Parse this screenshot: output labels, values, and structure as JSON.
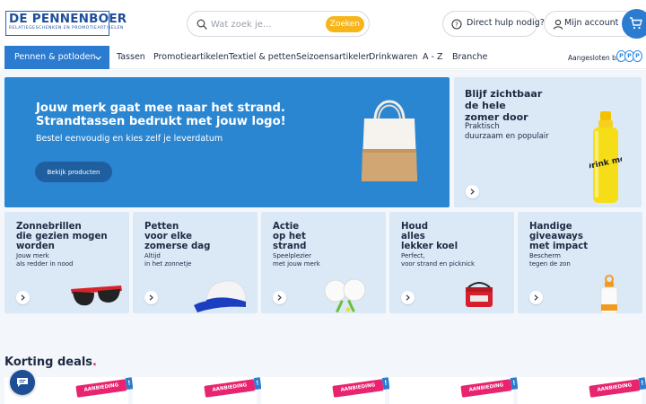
{
  "header": {
    "logo_main": "DE PENNENBOER",
    "logo_sub": "RELATIEGESCHENKEN EN PROMOTIEARTIKELEN",
    "search_placeholder": "Wat zoek je...",
    "search_button": "Zoeken",
    "help_label": "Direct hulp nodig?",
    "account_label": "Mijn account"
  },
  "nav": {
    "active_label": "Pennen & potloden",
    "items": [
      "Tassen",
      "Promotieartikelen",
      "Textiel & petten",
      "Seizoensartikelen",
      "Drinkwaren",
      "A - Z",
      "Branche"
    ],
    "aangesloten": "Aangesloten bij",
    "dots": [
      "P",
      "P",
      "P"
    ]
  },
  "hero": {
    "title_line1": "Jouw merk gaat mee naar het strand.",
    "title_line2": "Strandtassen bedrukt met jouw logo!",
    "subtitle": "Bestel eenvoudig en kies zelf je leverdatum",
    "button": "Bekijk producten"
  },
  "summer": {
    "title": [
      "Blijf zichtbaar",
      "de hele",
      "zomer door"
    ],
    "sub": [
      "Praktisch",
      "duurzaam en populair"
    ],
    "bottle_text": "Drink me"
  },
  "cards": [
    {
      "title": [
        "Zonnebrillen",
        "die gezien mogen",
        "worden"
      ],
      "sub": [
        "Jouw merk",
        "als redder in nood"
      ]
    },
    {
      "title": [
        "Petten",
        "voor elke",
        "zomerse dag"
      ],
      "sub": [
        "Altijd",
        "in het zonnetje"
      ]
    },
    {
      "title": [
        "Actie",
        "op het",
        "strand"
      ],
      "sub": [
        "Speelplezier",
        "met jouw merk"
      ]
    },
    {
      "title": [
        "Houd",
        "alles",
        "lekker koel"
      ],
      "sub": [
        "Perfect,",
        "voor strand en picknick"
      ]
    },
    {
      "title": [
        "Handige",
        "giveaways",
        "met impact"
      ],
      "sub": [
        "Bescherm",
        "tegen de zon"
      ]
    }
  ],
  "deals": {
    "title": "Korting deals",
    "dot": ".",
    "badge": "AANBIEDING",
    "badge_excl": "!"
  },
  "colors": {
    "primary": "#2b7bd0",
    "hero_bg": "#2b86d2",
    "card_bg": "#dbe8f6",
    "accent_yellow": "#f7b51c",
    "accent_pink": "#e8246f",
    "text": "#1f2a44"
  }
}
